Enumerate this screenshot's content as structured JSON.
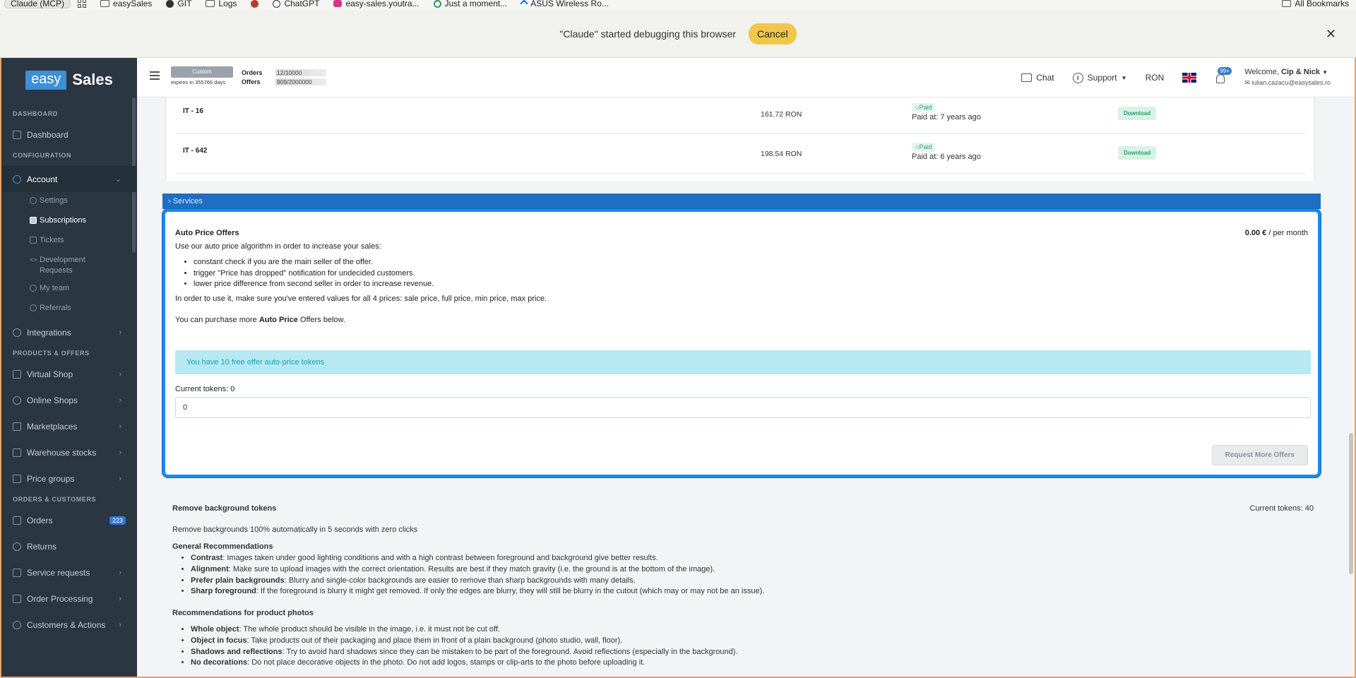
{
  "browser": {
    "profile": "Claude (MCP)",
    "bookmarks": [
      "easySales",
      "GIT",
      "Logs",
      "",
      "ChatGPT",
      "easy-sales.youtra...",
      "Just a moment...",
      "ASUS Wireless Ro..."
    ],
    "all_bookmarks": "All Bookmarks",
    "debug_message": "\"Claude\" started debugging this browser",
    "cancel_label": "Cancel"
  },
  "sidebar": {
    "logo_left": "easy",
    "logo_right": "Sales",
    "sections": {
      "dashboard": "DASHBOARD",
      "configuration": "CONFIGURATION",
      "products": "PRODUCTS & OFFERS",
      "orders": "ORDERS & CUSTOMERS"
    },
    "dashboard": "Dashboard",
    "account": "Account",
    "account_sub": [
      "Settings",
      "Subscriptions",
      "Tickets",
      "Development Requests",
      "My team",
      "Referrals"
    ],
    "integrations": "Integrations",
    "products_items": [
      "Virtual Shop",
      "Online Shops",
      "Marketplaces",
      "Warehouse stocks",
      "Price groups"
    ],
    "orders": "Orders",
    "orders_badge": "223",
    "orders_items": [
      "Returns",
      "Service requests",
      "Order Processing",
      "Customers & Actions"
    ]
  },
  "topbar": {
    "plan": "Custom",
    "expires": "expires in 355766 days",
    "orders_label": "Orders",
    "orders_value": "12/10000",
    "offers_label": "Offers",
    "offers_value": "909/2000000",
    "chat": "Chat",
    "support": "Support",
    "currency": "RON",
    "notif_badge": "99+",
    "welcome_prefix": "Welcome, ",
    "welcome_name": "Cip & Nick",
    "email": "iulian.cazacu@easysales.ro"
  },
  "invoices": [
    {
      "id": "IT - 16",
      "amount": "161.72 RON",
      "status": "Paid",
      "paid_at": "Paid at: 7 years ago",
      "action": "Download"
    },
    {
      "id": "IT - 642",
      "amount": "198.54 RON",
      "status": "Paid",
      "paid_at": "Paid at: 6 years ago",
      "action": "Download"
    }
  ],
  "services_label": "Services",
  "auto_price": {
    "title": "Auto Price Offers",
    "price": "0.00 €",
    "period": " / per month",
    "intro": "Use our auto price algorithm in order to increase your sales:",
    "bullets": [
      "constant check if you are the main seller of the offer.",
      "trigger \"Price has dropped\" notification for undecided customers.",
      "lower price difference from second seller in order to increase revenue."
    ],
    "p1": "In order to use it, make sure you've entered values for all 4 prices: sale price, full price, min price, max price.",
    "p2_pre": "You can purchase more ",
    "p2_bold": "Auto Price",
    "p2_post": " Offers below.",
    "alert": "You have 10 free offer auto-price tokens",
    "tokens_label": "Current tokens: 0",
    "input_value": "0",
    "request_button": "Request More Offers"
  },
  "remove_bg": {
    "title": "Remove background tokens",
    "tokens": "Current tokens: 40",
    "desc": "Remove backgrounds 100% automatically in 5 seconds with zero clicks",
    "general_title": "General Recommendations",
    "general": [
      {
        "b": "Contrast",
        "t": ": Images taken under good lighting conditions and with a high contrast between foreground and background give better results."
      },
      {
        "b": "Alignment",
        "t": ": Make sure to upload images with the correct orientation. Results are best if they match gravity (i.e. the ground is at the bottom of the image)."
      },
      {
        "b": "Prefer plain backgrounds",
        "t": ": Blurry and single-color backgrounds are easier to remove than sharp backgrounds with many details."
      },
      {
        "b": "Sharp foreground",
        "t": ": If the foreground is blurry it might get removed. If only the edges are blurry, they will still be blurry in the cutout (which may or may not be an issue)."
      }
    ],
    "product_title": "Recommendations for product photos",
    "product": [
      {
        "b": "Whole object",
        "t": ": The whole product should be visible in the image, i.e. it must not be cut off."
      },
      {
        "b": "Object in focus",
        "t": ": Take products out of their packaging and place them in front of a plain background (photo studio, wall, floor)."
      },
      {
        "b": "Shadows and reflections",
        "t": ": Try to avoid hard shadows since they can be mistaken to be part of the foreground. Avoid reflections (especially in the background)."
      },
      {
        "b": "No decorations",
        "t": ": Do not place decorative objects in the photo. Do not add logos, stamps or clip-arts to the photo before uploading it."
      }
    ]
  }
}
